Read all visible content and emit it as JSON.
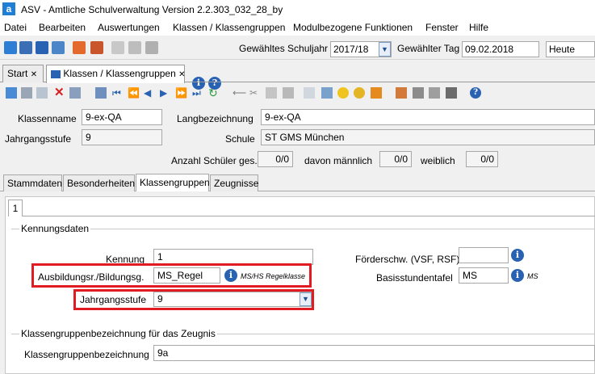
{
  "window": {
    "title": "ASV - Amtliche Schulverwaltung Version 2.2.303_032_28_by",
    "app_letter": "a"
  },
  "menu": [
    "Datei",
    "Bearbeiten",
    "Auswertungen",
    "Klassen / Klassengruppen",
    "Modulbezogene Funktionen",
    "Fenster",
    "Hilfe"
  ],
  "toolbar": {
    "schuljahr_label": "Gewähltes Schuljahr",
    "schuljahr_value": "2017/18",
    "tag_label": "Gewählter Tag",
    "tag_value": "09.02.2018",
    "heute_value": "Heute"
  },
  "tabs": {
    "start": "Start",
    "klassen": "Klassen / Klassengruppen",
    "close": "✕"
  },
  "header": {
    "klassenname_label": "Klassenname",
    "klassenname_value": "9-ex-QA",
    "langbezeichnung_label": "Langbezeichnung",
    "langbezeichnung_value": "9-ex-QA",
    "jahrgangsstufe_label": "Jahrgangsstufe",
    "jahrgangsstufe_value": "9",
    "schule_label": "Schule",
    "schule_value": "ST GMS München",
    "anzahl_label": "Anzahl Schüler ges.",
    "anzahl_value": "0/0",
    "maennlich_label": "davon männlich",
    "maennlich_value": "0/0",
    "weiblich_label": "weiblich",
    "weiblich_value": "0/0"
  },
  "inner_tabs": [
    "Stammdaten",
    "Besonderheiten",
    "Klassengruppen",
    "Zeugnisse"
  ],
  "subtab": "1",
  "kennungsdaten": {
    "section_title": "Kennungsdaten",
    "kennung_label": "Kennung",
    "kennung_value": "1",
    "ausbildung_label": "Ausbildungsr./Bildungsg.",
    "ausbildung_value": "MS_Regel",
    "ausbildung_hint": "MS/HS Regelklasse",
    "jahrgangsstufe_label": "Jahrgangsstufe",
    "jahrgangsstufe_value": "9",
    "foerder_label": "Förderschw. (VSF, RSF)",
    "foerder_value": "",
    "basis_label": "Basisstundentafel",
    "basis_value": "MS",
    "basis_hint": "MS"
  },
  "zeugnis": {
    "section_title": "Klassengruppenbezeichnung für das Zeugnis",
    "label": "Klassengruppenbezeichnung",
    "value": "9a"
  },
  "icons": [
    "info-icon",
    "combo-arrow-icon",
    "new-icon",
    "save-icon",
    "delete-icon",
    "first-icon",
    "prev-icon",
    "next-icon",
    "last-icon",
    "refresh-icon",
    "help-icon"
  ],
  "colors": {
    "highlight": "#e11b22",
    "accent": "#2a62b3"
  }
}
